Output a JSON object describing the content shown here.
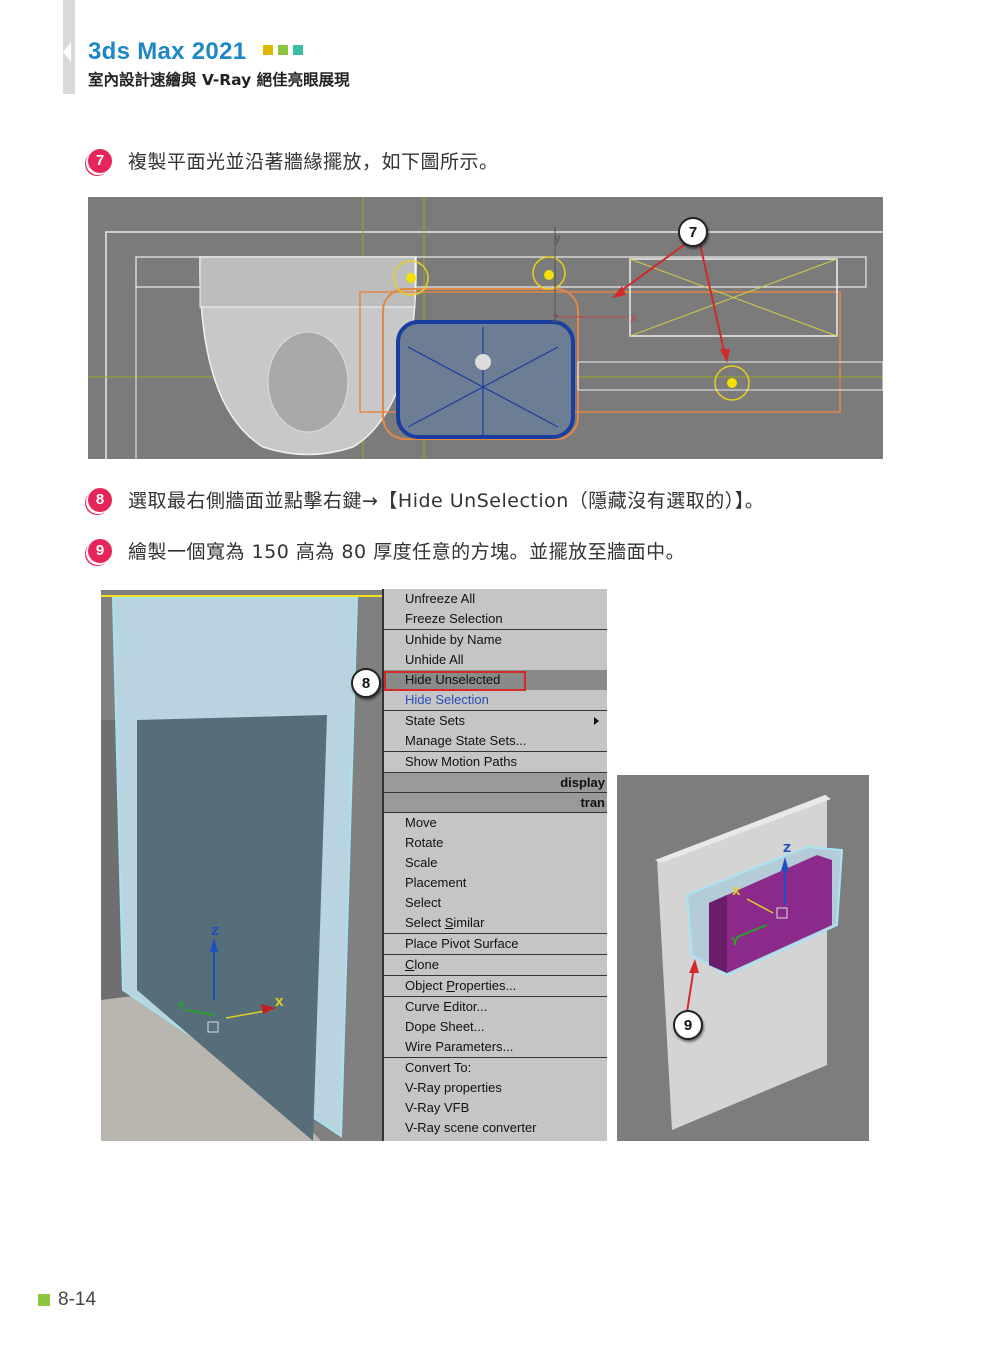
{
  "header": {
    "book_title": "3ds Max 2021",
    "book_subtitle": "室內設計速繪與 V-Ray 絕佳亮眼展現",
    "accent_squares": [
      "#e0b800",
      "#8cc63f",
      "#3dbfa6"
    ]
  },
  "steps": [
    {
      "number": "7",
      "text": "複製平面光並沿著牆緣擺放，如下圖所示。"
    },
    {
      "number": "8",
      "text": "選取最右側牆面並點擊右鍵→【Hide UnSelection（隱藏沒有選取的）】。"
    },
    {
      "number": "9",
      "text": "繪製一個寬為 150 高為 80 厚度任意的方塊。並擺放至牆面中。"
    }
  ],
  "figures": {
    "top_viewport": {
      "callout": "7",
      "axis_labels": {
        "x": "x",
        "y": "y",
        "z": "z"
      }
    },
    "perspective_viewport": {
      "callout": "8",
      "axis_labels": {
        "x": "X",
        "y": "Y",
        "z": "Z"
      }
    },
    "box_viewport": {
      "callout": "9",
      "axis_labels": {
        "x": "X",
        "y": "Y",
        "z": "Z"
      }
    }
  },
  "context_menu": {
    "items": [
      {
        "label": "Unfreeze All"
      },
      {
        "label": "Freeze Selection"
      },
      {
        "label": "Unhide by Name"
      },
      {
        "label": "Unhide All"
      },
      {
        "label": "Hide Unselected",
        "highlighted": true
      },
      {
        "label": "Hide Selection"
      },
      {
        "label": "State Sets",
        "submenu": true
      },
      {
        "label": "Manage State Sets..."
      },
      {
        "label": "Show Motion Paths"
      },
      {
        "label": "display",
        "header": true
      },
      {
        "label": "tran",
        "header": true
      },
      {
        "label": "Move"
      },
      {
        "label": "Rotate"
      },
      {
        "label": "Scale"
      },
      {
        "label": "Placement"
      },
      {
        "label": "Select"
      },
      {
        "label": "Select Similar"
      },
      {
        "label": "Place Pivot Surface"
      },
      {
        "label": "Clone"
      },
      {
        "label": "Object Properties..."
      },
      {
        "label": "Curve Editor..."
      },
      {
        "label": "Dope Sheet..."
      },
      {
        "label": "Wire Parameters..."
      },
      {
        "label": "Convert To:"
      },
      {
        "label": "V-Ray properties"
      },
      {
        "label": "V-Ray VFB"
      },
      {
        "label": "V-Ray scene converter"
      }
    ]
  },
  "footer": {
    "page_number": "8-14"
  }
}
